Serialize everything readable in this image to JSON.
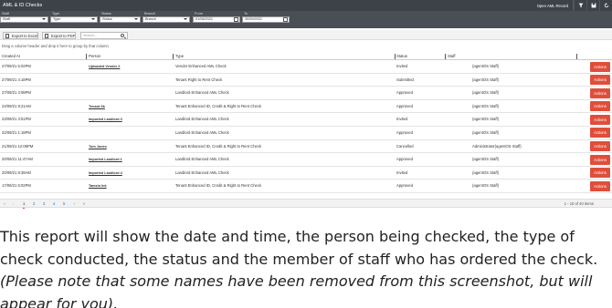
{
  "window": {
    "title": "AML & ID Checks",
    "open_record_label": "Open AML Record"
  },
  "filters": {
    "staff": {
      "label": "Staff",
      "value": "Staff"
    },
    "type": {
      "label": "Type",
      "value": "Type"
    },
    "status": {
      "label": "Status",
      "value": "Status"
    },
    "branch": {
      "label": "Branch",
      "value": "Branch"
    },
    "from": {
      "label": "From",
      "value": "01/08/2021"
    },
    "to": {
      "label": "To",
      "value": "30/09/2021"
    }
  },
  "toolbar": {
    "export_excel": "Export to Excel",
    "export_pdf": "Export to PDF",
    "search_placeholder": "Search..."
  },
  "group_hint": "Drag a column header and drop it here to group by that column",
  "columns": [
    "Created At",
    "Person",
    "Type",
    "Status",
    "Staff"
  ],
  "rows": [
    {
      "created": "27/09/21 5:02PM",
      "person": "Uploaded Vendor 2",
      "type": "Vendor Enhanced AML Check",
      "status": "Invited",
      "staff": "(agentOS Staff)"
    },
    {
      "created": "27/09/21 4:18PM",
      "person": "",
      "type": "Tenant Right to Rent Check",
      "status": "Submitted",
      "staff": "(agentOS Staff)"
    },
    {
      "created": "27/09/21 3:08PM",
      "person": "",
      "type": "Landlord Enhanced AML Check",
      "status": "Approved",
      "staff": "(agentOS Staff)"
    },
    {
      "created": "24/09/21 9:21AM",
      "person": "Tenant Sk",
      "type": "Tenant Enhanced ID, Credit & Right to Rent Check",
      "status": "Approved",
      "staff": "(agentOS Staff)"
    },
    {
      "created": "23/09/21 3:51PM",
      "person": "Imported Landlord 3",
      "type": "Landlord Enhanced AML Check",
      "status": "Invited",
      "staff": "(agentOS Staff)"
    },
    {
      "created": "22/09/21 1:18PM",
      "person": "",
      "type": "Landlord Enhanced AML Check",
      "status": "Approved",
      "staff": "(agentOS Staff)"
    },
    {
      "created": "21/09/21 12:08PM",
      "person": "Tom Jones",
      "type": "Tenant Enhanced ID, Credit & Right to Rent Check",
      "status": "Cancelled",
      "staff": "Administrator(agentOS Staff)"
    },
    {
      "created": "20/09/21 11:47AM",
      "person": "Imported Landlord 1",
      "type": "Landlord Enhanced AML Check",
      "status": "Approved",
      "staff": "(agentOS Staff)"
    },
    {
      "created": "20/09/21 9:39AM",
      "person": "Imported Landlord 4",
      "type": "Landlord Enhanced AML Check",
      "status": "Invited",
      "staff": "(agentOS Staff)"
    },
    {
      "created": "17/09/21 5:02PM",
      "person": "Tamsin Ink",
      "type": "Tenant Enhanced ID, Credit & Right to Rent Check",
      "status": "Approved",
      "staff": "(agentOS Staff)"
    }
  ],
  "actions_label": "Actions",
  "pager": {
    "first": "«",
    "prev": "‹",
    "pages": [
      "1",
      "2",
      "3",
      "4",
      "5"
    ],
    "next": "›",
    "last": "»",
    "info": "1 - 10 of 40 items"
  },
  "caption": {
    "main": "This report will show the date and time, the person being checked, the type of check conducted, the status and the member of staff who has ordered the check. ",
    "note": "(Please note that some names have been removed from this screenshot, but will appear for you)."
  },
  "colors": {
    "titlebar": "#3d4148",
    "filterbar": "#4a4e55",
    "actions": "#e04e3a",
    "link": "#2a6ebb"
  }
}
